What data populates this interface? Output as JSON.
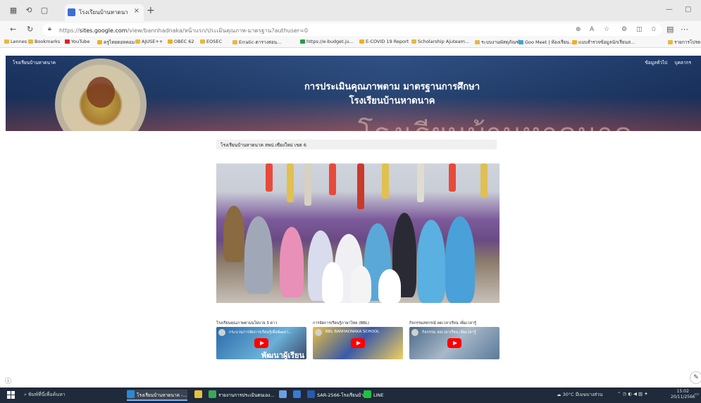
{
  "browser": {
    "tab_title": "โรงเรียนบ้านหาดนาค",
    "tab_close": "×",
    "new_tab": "+",
    "url_prefix": "https://",
    "url_host": "sites.google.com",
    "url_rest": "/view/bannhadnaka/หน้าแรก/ประเมินคุณภาพ-มาตรฐาน?authuser=0",
    "bookmarks": [
      "Lennes",
      "Bookmarks",
      "YouTube",
      "ครูไทยดอทคอม",
      "AJUSE++",
      "OBEC 62",
      "EOSEC",
      "Erratic-ตารางสอน...",
      "https://e-budget.ju...",
      "E-COVID 19 Report",
      "Scholarship Ajuteam...",
      "ระบบงานพัสดุภัณฑ์ฯ",
      "Goo Meet | ห้องเรียน...",
      "แบบสำรวจข้อมูลนักเรียนส...",
      "รายการโปรด"
    ]
  },
  "site": {
    "name": "โรงเรียนบ้านหาดนาค",
    "top_links": [
      "ข้อมูลทั่วไป",
      "บุคลากร"
    ],
    "title_line1": "การประเมินคุณภาพตาม มาตรฐานการศึกษา",
    "title_line2": "โรงเรียนบ้านหาดนาค",
    "banner_watermark": "โรงเรียนบ้านหาดนาค",
    "caption": "โรงเรียนบ้านหาดนาค สพป.เชียงใหม่ เขต 6"
  },
  "videos": [
    {
      "label": "โรงเรียนคุณภาพตามนโยบาย 3 ดาว",
      "title": "กระบวนการจัดการเรียนรู้เพื่อพัฒนา...",
      "overlay": "พัฒนาผู้เรียน"
    },
    {
      "label": "การจัดการเรียนรู้ภาษาไทย (BBL)",
      "title": "BBL BANHADNAKA SCHOOL",
      "overlay": ""
    },
    {
      "label": "กิจกรรมสหกรณ์ ลดเวลาเรียน เพิ่มเวลารู้",
      "title": "กิจกรรม ลดเวลาเรียน เพิ่มเวลารู้",
      "overlay": ""
    }
  ],
  "taskbar": {
    "search_text": "พิมพ์ที่นี่เพื่อค้นหา",
    "apps": [
      "โรงเรียนบ้านหาดนาค -...",
      "รายงานการประเมินตนเอง...",
      "SAR-2566-โรงเรียนบ้าน...",
      "LINE"
    ],
    "weather": "30°C มีเมฆบางส่วน",
    "time": "15:02",
    "date": "20/11/2566"
  },
  "colors": {
    "banner": "#1e3a66",
    "youtube_red": "#ff0000",
    "taskbar": "#1f2a3a"
  }
}
